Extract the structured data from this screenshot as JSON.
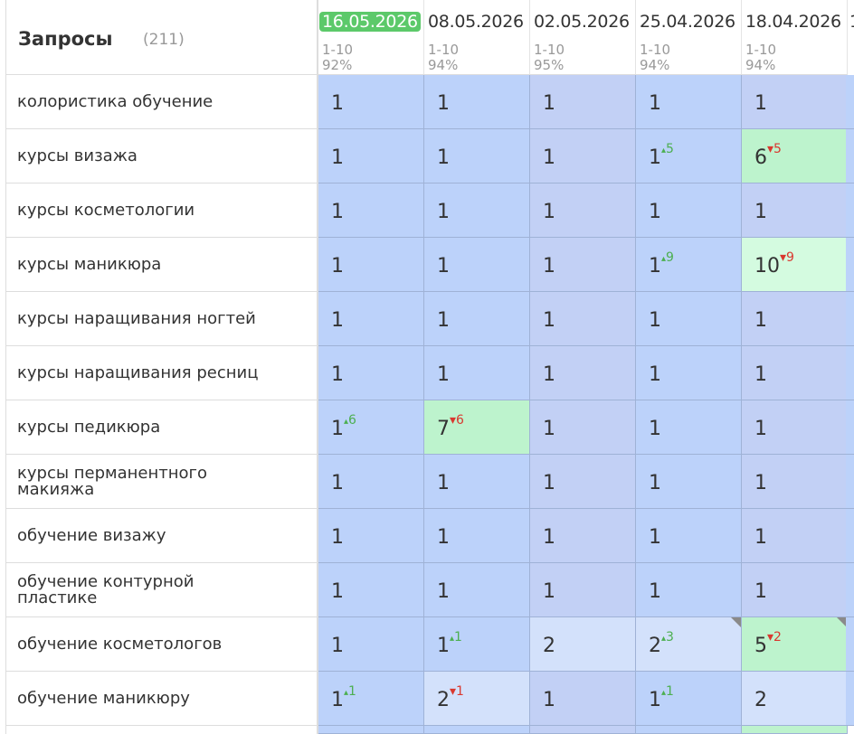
{
  "header": {
    "title": "Запросы",
    "count": "(211)"
  },
  "dates": [
    {
      "label": "16.05.2026",
      "range": "1-10",
      "percent": "92%",
      "active": true
    },
    {
      "label": "08.05.2026",
      "range": "1-10",
      "percent": "94%",
      "active": false
    },
    {
      "label": "02.05.2026",
      "range": "1-10",
      "percent": "95%",
      "active": false
    },
    {
      "label": "25.04.2026",
      "range": "1-10",
      "percent": "94%",
      "active": false
    },
    {
      "label": "18.04.2026",
      "range": "1-10",
      "percent": "94%",
      "active": false
    }
  ],
  "next_date_stub": "1",
  "colors": {
    "top1": "#bcd2fa",
    "top1_alt": "#c2d0f5",
    "pos2": "#d3e1fb",
    "green": "#bdf3cd",
    "green_light": "#d4fbe0",
    "active_date": "#5cc96a"
  },
  "rows": [
    {
      "query": "колористика обучение",
      "cells": [
        {
          "pos": "1",
          "delta": "",
          "dir": "",
          "bg": "top1"
        },
        {
          "pos": "1",
          "delta": "",
          "dir": "",
          "bg": "top1"
        },
        {
          "pos": "1",
          "delta": "",
          "dir": "",
          "bg": "top1_alt"
        },
        {
          "pos": "1",
          "delta": "",
          "dir": "",
          "bg": "top1"
        },
        {
          "pos": "1",
          "delta": "",
          "dir": "",
          "bg": "top1_alt"
        }
      ]
    },
    {
      "query": "курсы визажа",
      "cells": [
        {
          "pos": "1",
          "delta": "",
          "dir": "",
          "bg": "top1"
        },
        {
          "pos": "1",
          "delta": "",
          "dir": "",
          "bg": "top1"
        },
        {
          "pos": "1",
          "delta": "",
          "dir": "",
          "bg": "top1_alt"
        },
        {
          "pos": "1",
          "delta": "5",
          "dir": "up",
          "bg": "top1"
        },
        {
          "pos": "6",
          "delta": "5",
          "dir": "down",
          "bg": "green"
        }
      ]
    },
    {
      "query": "курсы косметологии",
      "cells": [
        {
          "pos": "1",
          "delta": "",
          "dir": "",
          "bg": "top1"
        },
        {
          "pos": "1",
          "delta": "",
          "dir": "",
          "bg": "top1"
        },
        {
          "pos": "1",
          "delta": "",
          "dir": "",
          "bg": "top1_alt"
        },
        {
          "pos": "1",
          "delta": "",
          "dir": "",
          "bg": "top1"
        },
        {
          "pos": "1",
          "delta": "",
          "dir": "",
          "bg": "top1_alt"
        }
      ]
    },
    {
      "query": "курсы маникюра",
      "cells": [
        {
          "pos": "1",
          "delta": "",
          "dir": "",
          "bg": "top1"
        },
        {
          "pos": "1",
          "delta": "",
          "dir": "",
          "bg": "top1"
        },
        {
          "pos": "1",
          "delta": "",
          "dir": "",
          "bg": "top1_alt"
        },
        {
          "pos": "1",
          "delta": "9",
          "dir": "up",
          "bg": "top1"
        },
        {
          "pos": "10",
          "delta": "9",
          "dir": "down",
          "bg": "green_light"
        }
      ]
    },
    {
      "query": "курсы наращивания ногтей",
      "cells": [
        {
          "pos": "1",
          "delta": "",
          "dir": "",
          "bg": "top1"
        },
        {
          "pos": "1",
          "delta": "",
          "dir": "",
          "bg": "top1"
        },
        {
          "pos": "1",
          "delta": "",
          "dir": "",
          "bg": "top1_alt"
        },
        {
          "pos": "1",
          "delta": "",
          "dir": "",
          "bg": "top1"
        },
        {
          "pos": "1",
          "delta": "",
          "dir": "",
          "bg": "top1_alt"
        }
      ]
    },
    {
      "query": "курсы наращивания ресниц",
      "cells": [
        {
          "pos": "1",
          "delta": "",
          "dir": "",
          "bg": "top1"
        },
        {
          "pos": "1",
          "delta": "",
          "dir": "",
          "bg": "top1"
        },
        {
          "pos": "1",
          "delta": "",
          "dir": "",
          "bg": "top1_alt"
        },
        {
          "pos": "1",
          "delta": "",
          "dir": "",
          "bg": "top1"
        },
        {
          "pos": "1",
          "delta": "",
          "dir": "",
          "bg": "top1_alt"
        }
      ]
    },
    {
      "query": "курсы педикюра",
      "cells": [
        {
          "pos": "1",
          "delta": "6",
          "dir": "up",
          "bg": "top1"
        },
        {
          "pos": "7",
          "delta": "6",
          "dir": "down",
          "bg": "green"
        },
        {
          "pos": "1",
          "delta": "",
          "dir": "",
          "bg": "top1_alt"
        },
        {
          "pos": "1",
          "delta": "",
          "dir": "",
          "bg": "top1"
        },
        {
          "pos": "1",
          "delta": "",
          "dir": "",
          "bg": "top1_alt"
        }
      ]
    },
    {
      "query": "курсы перманентного макияжа",
      "cells": [
        {
          "pos": "1",
          "delta": "",
          "dir": "",
          "bg": "top1"
        },
        {
          "pos": "1",
          "delta": "",
          "dir": "",
          "bg": "top1"
        },
        {
          "pos": "1",
          "delta": "",
          "dir": "",
          "bg": "top1_alt"
        },
        {
          "pos": "1",
          "delta": "",
          "dir": "",
          "bg": "top1"
        },
        {
          "pos": "1",
          "delta": "",
          "dir": "",
          "bg": "top1_alt"
        }
      ]
    },
    {
      "query": "обучение визажу",
      "cells": [
        {
          "pos": "1",
          "delta": "",
          "dir": "",
          "bg": "top1"
        },
        {
          "pos": "1",
          "delta": "",
          "dir": "",
          "bg": "top1"
        },
        {
          "pos": "1",
          "delta": "",
          "dir": "",
          "bg": "top1_alt"
        },
        {
          "pos": "1",
          "delta": "",
          "dir": "",
          "bg": "top1"
        },
        {
          "pos": "1",
          "delta": "",
          "dir": "",
          "bg": "top1_alt"
        }
      ]
    },
    {
      "query": "обучение контурной пластике",
      "cells": [
        {
          "pos": "1",
          "delta": "",
          "dir": "",
          "bg": "top1"
        },
        {
          "pos": "1",
          "delta": "",
          "dir": "",
          "bg": "top1"
        },
        {
          "pos": "1",
          "delta": "",
          "dir": "",
          "bg": "top1_alt"
        },
        {
          "pos": "1",
          "delta": "",
          "dir": "",
          "bg": "top1"
        },
        {
          "pos": "1",
          "delta": "",
          "dir": "",
          "bg": "top1_alt"
        }
      ]
    },
    {
      "query": "обучение косметологов",
      "cells": [
        {
          "pos": "1",
          "delta": "",
          "dir": "",
          "bg": "top1"
        },
        {
          "pos": "1",
          "delta": "1",
          "dir": "up",
          "bg": "top1"
        },
        {
          "pos": "2",
          "delta": "",
          "dir": "",
          "bg": "pos2"
        },
        {
          "pos": "2",
          "delta": "3",
          "dir": "up",
          "bg": "pos2",
          "corner": true
        },
        {
          "pos": "5",
          "delta": "2",
          "dir": "down",
          "bg": "green",
          "corner": true
        }
      ]
    },
    {
      "query": "обучение маникюру",
      "cells": [
        {
          "pos": "1",
          "delta": "1",
          "dir": "up",
          "bg": "top1"
        },
        {
          "pos": "2",
          "delta": "1",
          "dir": "down",
          "bg": "pos2"
        },
        {
          "pos": "1",
          "delta": "",
          "dir": "",
          "bg": "top1_alt"
        },
        {
          "pos": "1",
          "delta": "1",
          "dir": "up",
          "bg": "top1"
        },
        {
          "pos": "2",
          "delta": "",
          "dir": "",
          "bg": "pos2"
        }
      ]
    }
  ],
  "partial_row_bg": [
    "top1",
    "top1",
    "top1_alt",
    "top1",
    "green"
  ]
}
